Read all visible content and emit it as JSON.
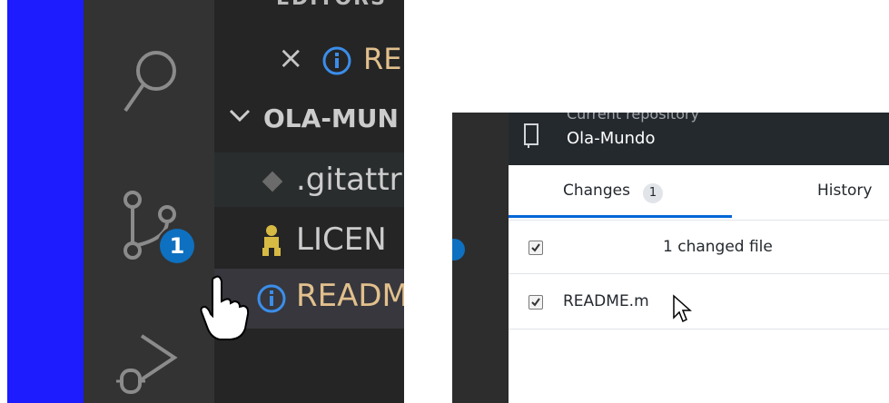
{
  "vscode": {
    "hidden_header": "EDITORS",
    "open_editor_label": "RE",
    "section_title": "OLA-MUN",
    "files": [
      {
        "name": ".gitattr",
        "icon": "git-diamond-icon"
      },
      {
        "name": "LICEN",
        "icon": "license-person-icon"
      },
      {
        "name": "READM",
        "icon": "info-icon"
      }
    ],
    "scm_badge": "1",
    "colors": {
      "accent_blue": "#1c1cff",
      "badge": "#0e70c0"
    }
  },
  "github_desktop": {
    "repo_label": "Current repository",
    "repo_name": "Ola-Mundo",
    "tabs": [
      {
        "label": "Changes",
        "badge": "1",
        "active": true
      },
      {
        "label": "History",
        "active": false
      }
    ],
    "summary": "1 changed file",
    "changed_files": [
      {
        "name": "README.m",
        "checked": true
      }
    ],
    "accent": "#0366d6"
  }
}
